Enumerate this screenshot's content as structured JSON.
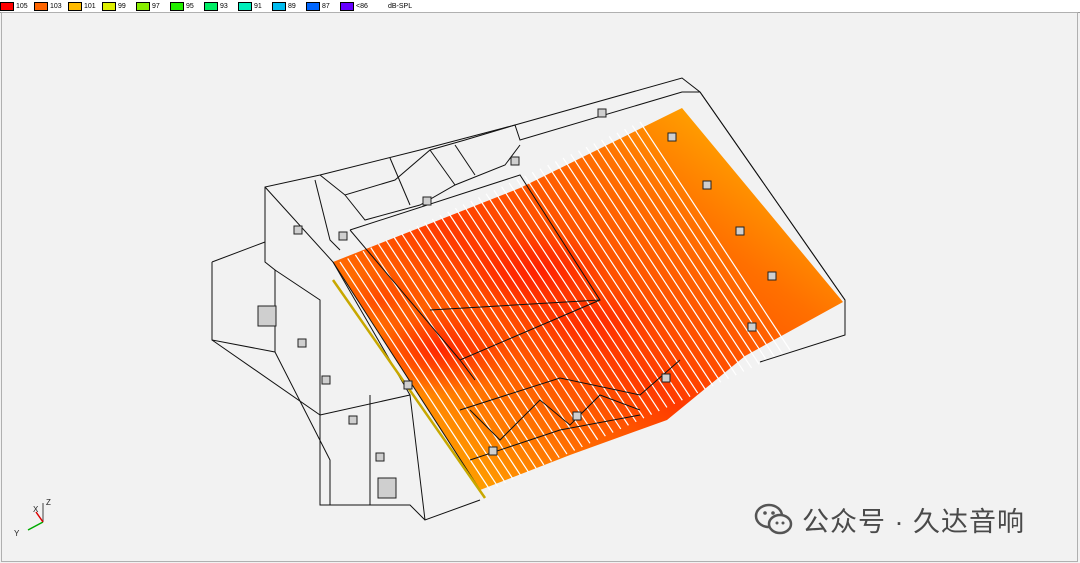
{
  "legend": {
    "items": [
      {
        "label": "105",
        "color": "#ff0000"
      },
      {
        "label": "103",
        "color": "#ff6600"
      },
      {
        "label": "101",
        "color": "#ffbb00"
      },
      {
        "label": "99",
        "color": "#ddee00"
      },
      {
        "label": "97",
        "color": "#88ee00"
      },
      {
        "label": "95",
        "color": "#22ee00"
      },
      {
        "label": "93",
        "color": "#00ee66"
      },
      {
        "label": "91",
        "color": "#00eebb"
      },
      {
        "label": "89",
        "color": "#00bbee"
      },
      {
        "label": "87",
        "color": "#0066ff"
      },
      {
        "label": "<86",
        "color": "#6600ff"
      }
    ],
    "unit": "dB-SPL"
  },
  "axes": {
    "x": "X",
    "y": "Y",
    "z": "Z"
  },
  "watermark": {
    "text": "公众号 · 久达音响",
    "icon": "wechat-icon"
  },
  "chart_data": {
    "type": "heatmap",
    "title": "",
    "unit": "dB-SPL",
    "scale_levels": [
      "105",
      "103",
      "101",
      "99",
      "97",
      "95",
      "93",
      "91",
      "89",
      "87",
      "<86"
    ],
    "observed_range_dB": [
      100,
      105
    ],
    "description_of_field": "SPL coverage map projected on stepped audience seating of auditorium 3D model"
  }
}
